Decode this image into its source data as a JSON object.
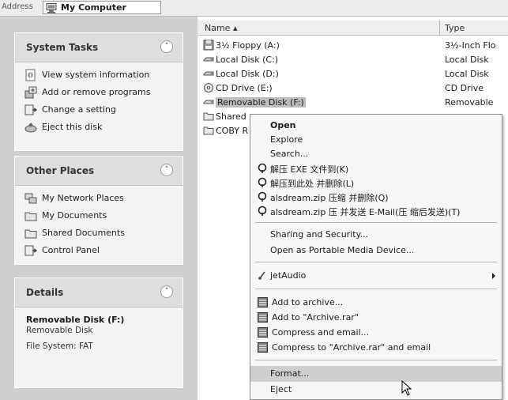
{
  "address": {
    "label": "Address",
    "location": "My Computer"
  },
  "panels": {
    "system_tasks": {
      "title": "System Tasks",
      "items": [
        {
          "label": "View system information",
          "icon": "info-icon"
        },
        {
          "label": "Add or remove programs",
          "icon": "programs-icon"
        },
        {
          "label": "Change a setting",
          "icon": "control-panel-icon"
        },
        {
          "label": "Eject this disk",
          "icon": "eject-icon"
        }
      ]
    },
    "other_places": {
      "title": "Other Places",
      "items": [
        {
          "label": "My Network Places",
          "icon": "network-icon"
        },
        {
          "label": "My Documents",
          "icon": "folder-icon"
        },
        {
          "label": "Shared Documents",
          "icon": "folder-icon"
        },
        {
          "label": "Control Panel",
          "icon": "control-panel-icon"
        }
      ]
    },
    "details": {
      "title": "Details",
      "name": "Removable Disk (F:)",
      "type": "Removable Disk",
      "filesystem": "File System: FAT"
    }
  },
  "filelist": {
    "columns": {
      "name": "Name",
      "type": "Type"
    },
    "rows": [
      {
        "name": "3½ Floppy (A:)",
        "type": "3½-Inch Flo",
        "icon": "floppy-icon"
      },
      {
        "name": "Local Disk (C:)",
        "type": "Local Disk",
        "icon": "hard-disk-icon"
      },
      {
        "name": "Local Disk (D:)",
        "type": "Local Disk",
        "icon": "hard-disk-icon"
      },
      {
        "name": "CD Drive (E:)",
        "type": "CD Drive",
        "icon": "cd-drive-icon"
      },
      {
        "name": "Removable Disk (F:)",
        "type": "Removable",
        "icon": "removable-disk-icon"
      },
      {
        "name": "Shared",
        "type": "",
        "icon": "folder-icon"
      },
      {
        "name": "COBY R",
        "type": "",
        "icon": "folder-icon"
      }
    ]
  },
  "context_menu": {
    "items": [
      {
        "label": "Open"
      },
      {
        "label": "Explore"
      },
      {
        "label": "Search..."
      },
      {
        "label": "解压 EXE 文件到(K)"
      },
      {
        "label": "解压到此处 并删除(L)"
      },
      {
        "label": "alsdream.zip 压缩 并删除(Q)"
      },
      {
        "label": "alsdream.zip 压 并发送 E-Mail(压 缩后发送)(T)"
      },
      {
        "label": "Sharing and Security..."
      },
      {
        "label": "Open as Portable Media Device..."
      },
      {
        "label": "jetAudio"
      },
      {
        "label": "Add to archive..."
      },
      {
        "label": "Add to \"Archive.rar\""
      },
      {
        "label": "Compress and email..."
      },
      {
        "label": "Compress to \"Archive.rar\" and email"
      },
      {
        "label": "Format..."
      },
      {
        "label": "Eject"
      }
    ]
  },
  "colors": {
    "pane": "#cfcfcf",
    "highlight": "#cfcfcf"
  }
}
